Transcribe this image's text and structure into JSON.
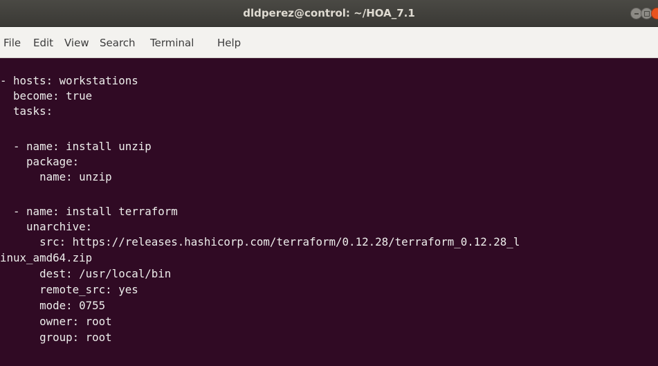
{
  "window": {
    "title": "dldperez@control: ~/HOA_7.1"
  },
  "window_buttons": [
    "minimize",
    "maximize",
    "close"
  ],
  "menu": {
    "items": [
      "File",
      "Edit",
      "View",
      "Search",
      "Terminal",
      "Help"
    ]
  },
  "terminal": {
    "background": "#300a24",
    "foreground": "#eeeeec",
    "lines": [
      "- hosts: workstations",
      "  become: true",
      "  tasks:",
      "",
      "  - name: install unzip",
      "    package:",
      "      name: unzip",
      "",
      "  - name: install terraform",
      "    unarchive:",
      "      src: https://releases.hashicorp.com/terraform/0.12.28/terraform_0.12.28_l",
      "inux_amd64.zip",
      "      dest: /usr/local/bin",
      "      remote_src: yes",
      "      mode: 0755",
      "      owner: root",
      "      group: root"
    ]
  }
}
